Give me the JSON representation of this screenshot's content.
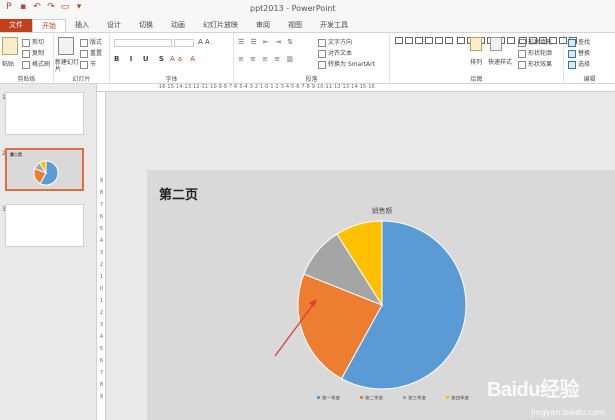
{
  "window": {
    "title": "ppt2013 - PowerPoint"
  },
  "tabs": [
    {
      "label": "文件",
      "kind": "file"
    },
    {
      "label": "开始",
      "kind": "active"
    },
    {
      "label": "插入",
      "kind": ""
    },
    {
      "label": "设计",
      "kind": ""
    },
    {
      "label": "切换",
      "kind": ""
    },
    {
      "label": "动画",
      "kind": ""
    },
    {
      "label": "幻灯片放映",
      "kind": ""
    },
    {
      "label": "审阅",
      "kind": ""
    },
    {
      "label": "视图",
      "kind": ""
    },
    {
      "label": "开发工具",
      "kind": ""
    }
  ],
  "ribbon": {
    "clipboard": {
      "label": "剪贴板",
      "paste": "粘贴",
      "cut": "剪切",
      "copy": "复制",
      "format_painter": "格式刷"
    },
    "slides": {
      "label": "幻灯片",
      "new_slide": "新建幻灯片",
      "layout": "版式",
      "reset": "重置",
      "section": "节"
    },
    "font": {
      "label": "字体"
    },
    "paragraph": {
      "label": "段落",
      "text_direction": "文字方向",
      "align_text": "对齐文本",
      "convert_smartart": "转换为 SmartArt"
    },
    "drawing": {
      "label": "绘图",
      "arrange": "排列",
      "quick_styles": "快速样式",
      "shape_fill": "形状填充",
      "shape_outline": "形状轮廓",
      "shape_effects": "形状效果"
    },
    "editing": {
      "label": "编辑",
      "find": "查找",
      "replace": "替换",
      "select": "选择"
    }
  },
  "ruler": {
    "ticks": "·16·15·14·13·12·11·10·9·8·7·6·5·4·3·2·1·0·1·2·3·4·5·6·7·8·9·10·11·12·13·14·15·16"
  },
  "vruler": [
    "9",
    "8",
    "7",
    "6",
    "5",
    "4",
    "3",
    "2",
    "1",
    "0",
    "1",
    "2",
    "3",
    "4",
    "5",
    "6",
    "7",
    "8",
    "9"
  ],
  "thumbnails": [
    {
      "num": "1",
      "title": "",
      "selected": false
    },
    {
      "num": "2",
      "title": "第二页",
      "selected": true
    },
    {
      "num": "3",
      "title": "",
      "selected": false
    }
  ],
  "slide": {
    "title": "第二页"
  },
  "watermark": {
    "brand": "Baidu经验",
    "url": "jingyan.baidu.com"
  },
  "chart_data": {
    "type": "pie",
    "title": "销售额",
    "categories": [
      "第一季度",
      "第二季度",
      "第三季度",
      "第四季度"
    ],
    "values": [
      58,
      23,
      10,
      9
    ],
    "colors": [
      "#5b9bd5",
      "#ed7d31",
      "#a5a5a5",
      "#ffc000"
    ],
    "legend_position": "bottom"
  },
  "annotation": {
    "arrow_color": "#e03c31"
  }
}
